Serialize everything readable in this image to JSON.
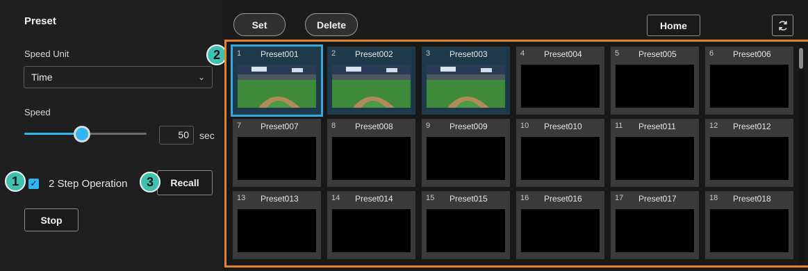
{
  "left_panel": {
    "title": "Preset",
    "speed_unit_label": "Speed Unit",
    "speed_unit_value": "Time",
    "speed_label": "Speed",
    "speed_value": "50",
    "speed_slider_fraction": 0.47,
    "speed_unit": "sec",
    "two_step_label": "2 Step Operation",
    "two_step_checked": true,
    "recall_label": "Recall",
    "stop_label": "Stop"
  },
  "markers": {
    "m1": "1",
    "m2": "2",
    "m3": "3"
  },
  "toolbar": {
    "set_label": "Set",
    "delete_label": "Delete",
    "home_label": "Home"
  },
  "presets": [
    {
      "num": "1",
      "name": "Preset001",
      "image": true,
      "selected": true
    },
    {
      "num": "2",
      "name": "Preset002",
      "image": true
    },
    {
      "num": "3",
      "name": "Preset003",
      "image": true
    },
    {
      "num": "4",
      "name": "Preset004"
    },
    {
      "num": "5",
      "name": "Preset005"
    },
    {
      "num": "6",
      "name": "Preset006"
    },
    {
      "num": "7",
      "name": "Preset007"
    },
    {
      "num": "8",
      "name": "Preset008"
    },
    {
      "num": "9",
      "name": "Preset009"
    },
    {
      "num": "10",
      "name": "Preset010"
    },
    {
      "num": "11",
      "name": "Preset011"
    },
    {
      "num": "12",
      "name": "Preset012"
    },
    {
      "num": "13",
      "name": "Preset013"
    },
    {
      "num": "14",
      "name": "Preset014"
    },
    {
      "num": "15",
      "name": "Preset015"
    },
    {
      "num": "16",
      "name": "Preset016"
    },
    {
      "num": "17",
      "name": "Preset017"
    },
    {
      "num": "18",
      "name": "Preset018"
    }
  ],
  "colors": {
    "accent": "#2fb5f0",
    "highlight_frame": "#e5822e",
    "marker": "#3fc1b0"
  }
}
